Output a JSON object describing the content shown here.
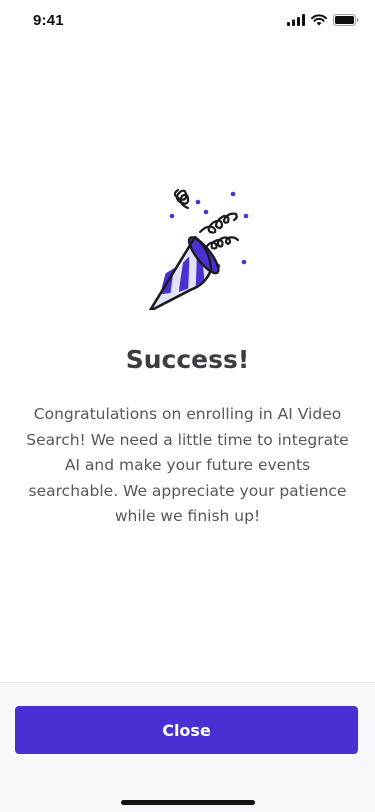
{
  "status_bar": {
    "time": "9:41",
    "icons": [
      "cellular-signal-icon",
      "wifi-icon",
      "battery-icon"
    ]
  },
  "illustration": {
    "icon": "party-popper-icon",
    "colors": {
      "primary": "#4a2fd3",
      "light": "#e3e3f7",
      "outline": "#1b1b1b"
    }
  },
  "content": {
    "title": "Success!",
    "message": "Congratulations on enrolling in AI Video Search! We need a little time to integrate AI and make your future events searchable. We appreciate your patience while we finish up!"
  },
  "footer": {
    "close_label": "Close"
  },
  "colors": {
    "accent": "#4a2fd3",
    "footer_background": "#f6f8fb"
  }
}
